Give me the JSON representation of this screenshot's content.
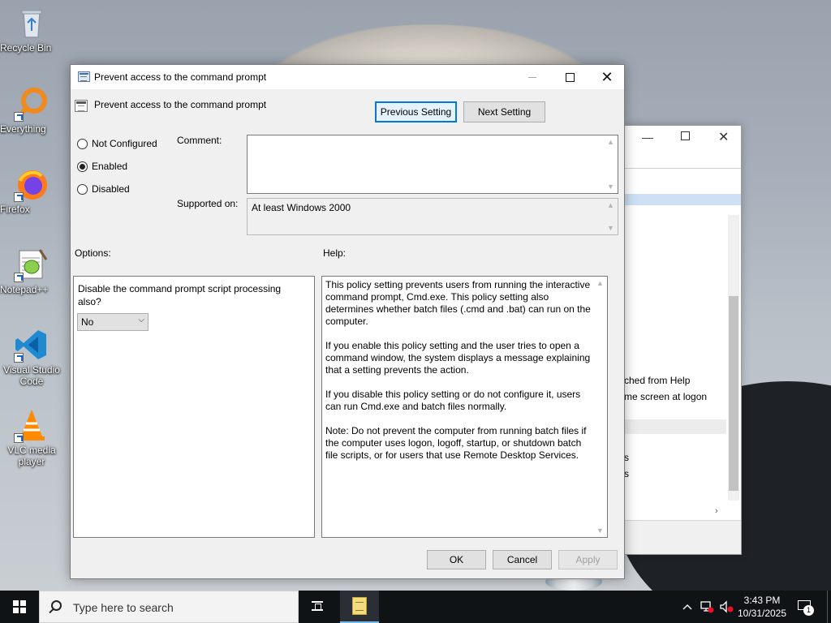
{
  "desktop": {
    "icons": [
      {
        "label": "Recycle Bin",
        "icon": "recycle-bin-icon"
      },
      {
        "label": "Everything",
        "icon": "everything-search-icon"
      },
      {
        "label": "Firefox",
        "icon": "firefox-icon"
      },
      {
        "label": "Notepad++",
        "icon": "notepad-plus-plus-icon"
      },
      {
        "label": "Visual Studio Code",
        "icon": "vscode-icon"
      },
      {
        "label": "VLC media player",
        "icon": "vlc-icon"
      }
    ]
  },
  "background_window": {
    "fragments": [
      "ched from Help",
      "me screen at logon",
      "s",
      "s"
    ]
  },
  "dialog": {
    "title": "Prevent access to the command prompt",
    "header_title": "Prevent access to the command prompt",
    "previous_button": "Previous Setting",
    "next_button": "Next Setting",
    "radio_options": [
      {
        "label": "Not Configured",
        "checked": false
      },
      {
        "label": "Enabled",
        "checked": true
      },
      {
        "label": "Disabled",
        "checked": false
      }
    ],
    "comment_label": "Comment:",
    "comment_value": "",
    "supported_label": "Supported on:",
    "supported_value": "At least Windows 2000",
    "options_label": "Options:",
    "help_label": "Help:",
    "option_text": "Disable the command prompt script processing also?",
    "option_select_value": "No",
    "help_paragraphs": [
      "This policy setting prevents users from running the interactive command prompt, Cmd.exe.  This policy setting also determines whether batch files (.cmd and .bat) can run on the computer.",
      "If you enable this policy setting and the user tries to open a command window, the system displays a message explaining that a setting prevents the action.",
      "If you disable this policy setting or do not configure it, users can run Cmd.exe and batch files normally.",
      "Note: Do not prevent the computer from running batch files if the computer uses logon, logoff, startup, or shutdown batch file scripts, or for users that use Remote Desktop Services."
    ],
    "ok_button": "OK",
    "cancel_button": "Cancel",
    "apply_button": "Apply"
  },
  "taskbar": {
    "search_placeholder": "Type here to search",
    "time": "3:43 PM",
    "date": "10/31/2025",
    "notification_count": "1"
  },
  "colors": {
    "accent": "#0078d7",
    "taskbar": "#101316",
    "dialog_bg": "#f0f0f0"
  }
}
